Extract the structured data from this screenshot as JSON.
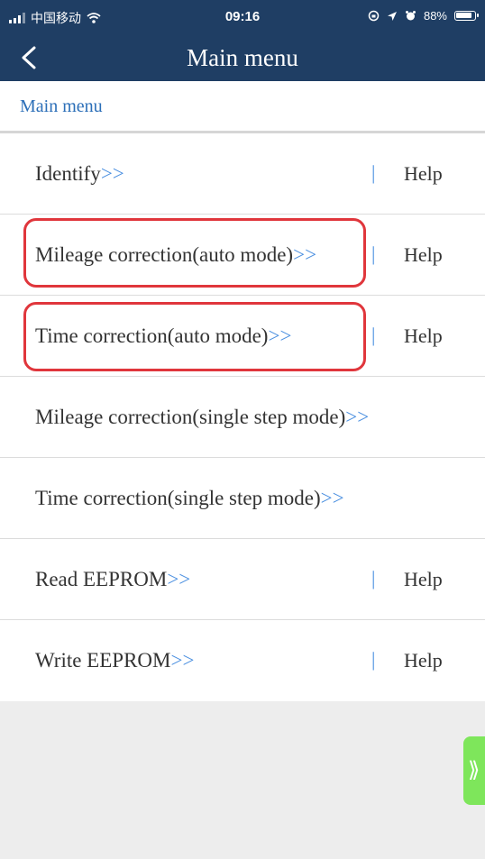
{
  "status_bar": {
    "carrier": "中国移动",
    "time": "09:16",
    "battery": "88%"
  },
  "nav": {
    "title": "Main menu"
  },
  "breadcrumb": "Main menu",
  "menu": {
    "items": [
      {
        "label": "Identify",
        "arrow": ">>",
        "sep": "|",
        "help": "Help"
      },
      {
        "label": "Mileage correction(auto mode)",
        "arrow": ">>",
        "sep": "|",
        "help": "Help"
      },
      {
        "label": "Time correction(auto mode)",
        "arrow": ">>",
        "sep": "|",
        "help": "Help"
      },
      {
        "label": "Mileage correction(single step mode)",
        "arrow": ">>"
      },
      {
        "label": "Time correction(single step mode)",
        "arrow": ">>"
      },
      {
        "label": "Read EEPROM",
        "arrow": ">>",
        "sep": "|",
        "help": "Help"
      },
      {
        "label": "Write EEPROM",
        "arrow": ">>",
        "sep": "|",
        "help": "Help"
      }
    ]
  },
  "side_tab": {
    "glyph": "⟫"
  },
  "colors": {
    "header": "#1f3e64",
    "link": "#4a8fe0",
    "highlight": "#e0363c",
    "side_tab": "#7ee65b"
  }
}
